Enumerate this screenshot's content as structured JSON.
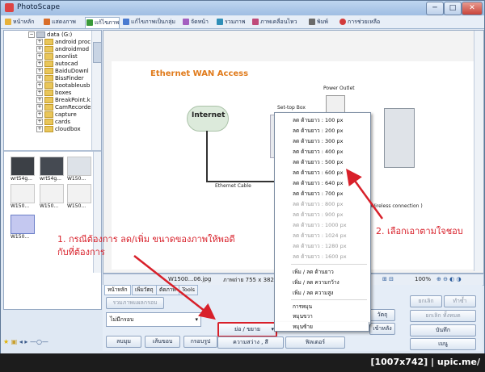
{
  "window": {
    "title": "PhotoScape",
    "buttons": {
      "minimize": "─",
      "maximize": "□",
      "close": "✕"
    }
  },
  "tabs": [
    {
      "label": "หน้าหลัก",
      "icon": "home-icon"
    },
    {
      "label": "แสดงภาพ",
      "icon": "viewer-icon"
    },
    {
      "label": "แก้ไขภาพ",
      "icon": "editor-icon",
      "active": true
    },
    {
      "label": "แก้ไขภาพเป็นกลุ่ม",
      "icon": "batch-icon"
    },
    {
      "label": "จัดหน้า",
      "icon": "page-icon"
    },
    {
      "label": "รวมภาพ",
      "icon": "combine-icon"
    },
    {
      "label": "ภาพเคลื่อนไหว",
      "icon": "gif-icon"
    },
    {
      "label": "พิมพ์",
      "icon": "print-icon"
    },
    {
      "label": "การช่วยเหลือ",
      "icon": "help-icon"
    }
  ],
  "tree": {
    "root": "data (G:)",
    "items": [
      "android proc",
      "androidmod",
      "anonlist",
      "autocad",
      "BaiduDownl",
      "BissFinder",
      "bootablеusb",
      "boxes",
      "BreakPoint.k",
      "CamRecorde",
      "capture",
      "cards",
      "cloudbox"
    ]
  },
  "thumbnails": [
    {
      "label": "wrt54g..."
    },
    {
      "label": "wrt54g..."
    },
    {
      "label": "W150..."
    },
    {
      "label": "W150..."
    },
    {
      "label": "W150..."
    },
    {
      "label": "W150..."
    },
    {
      "label": "W150..."
    }
  ],
  "image": {
    "title": "Ethernet WAN Access",
    "labels": {
      "internet": "Internet",
      "power_outlet": "Power Outlet",
      "settop": "Set-top Box",
      "ethernet_cable": "Ethernet Cable",
      "wireless": "(Wireless connection )"
    }
  },
  "status": {
    "filename": "W1500...06.jpg",
    "dimensions": "ภาพถ่าย 755 x 382",
    "zoom": "100%"
  },
  "bottom_tabs": [
    "หน้าหลัก",
    "เพิ่มวัตถุ",
    "ตัดภาพ",
    "Tools"
  ],
  "bottom": {
    "combine_btn": "รวมภาพแผลกรอบ",
    "frame_select": "ไม่มีกรอบ",
    "round_btn": "ลบมุม",
    "margin_btn": "เส้นขอบ",
    "frame_btn": "กรอบรูป",
    "resize_btn": "ย่อ / ขยาย",
    "brightness_btn": "ความสว่าง , สี",
    "filter_btn": "ฟิลเตอร์",
    "object_select": "วัตถุ",
    "backlight_select": "เข้าหลัง",
    "undo_btn": "ยกเลิก",
    "redo_btn": "ทำซ้ำ",
    "undo_all_btn": "ยกเลิก ทั้งหมด",
    "save_btn": "บันทึก",
    "menu_btn": "เมนู"
  },
  "resize_menu": {
    "items": [
      {
        "label": "ลด ด้านยาว : 100 px",
        "enabled": true
      },
      {
        "label": "ลด ด้านยาว : 200 px",
        "enabled": true
      },
      {
        "label": "ลด ด้านยาว : 300 px",
        "enabled": true
      },
      {
        "label": "ลด ด้านยาว : 400 px",
        "enabled": true
      },
      {
        "label": "ลด ด้านยาว : 500 px",
        "enabled": true
      },
      {
        "label": "ลด ด้านยาว : 600 px",
        "enabled": true
      },
      {
        "label": "ลด ด้านยาว : 640 px",
        "enabled": true
      },
      {
        "label": "ลด ด้านยาว : 700 px",
        "enabled": true
      },
      {
        "label": "ลด ด้านยาว : 800 px",
        "enabled": false
      },
      {
        "label": "ลด ด้านยาว : 900 px",
        "enabled": false
      },
      {
        "label": "ลด ด้านยาว : 1000 px",
        "enabled": false
      },
      {
        "label": "ลด ด้านยาว : 1024 px",
        "enabled": false
      },
      {
        "label": "ลด ด้านยาว : 1280 px",
        "enabled": false
      },
      {
        "label": "ลด ด้านยาว : 1600 px",
        "enabled": false
      }
    ],
    "group2": [
      "เพิ่ม / ลด ด้านยาว",
      "เพิ่ม / ลด ความกว้าง",
      "เพิ่ม / ลด ความสูง"
    ],
    "group3": [
      "การหมุน",
      "หมุนขวา",
      "หมุนซ้าย"
    ]
  },
  "callouts": {
    "left_line1": "1. กรณีต้องการ ลด/เพิ่ม ขนาดของภาพให้พอดี",
    "left_line2": "กับที่ต้องการ",
    "right": "2. เลือกเอาตามใจชอบ"
  },
  "footer": "[1007x742] | upic.me/",
  "colors": {
    "annotation": "#d8202a",
    "title_orange": "#e07b1c"
  }
}
